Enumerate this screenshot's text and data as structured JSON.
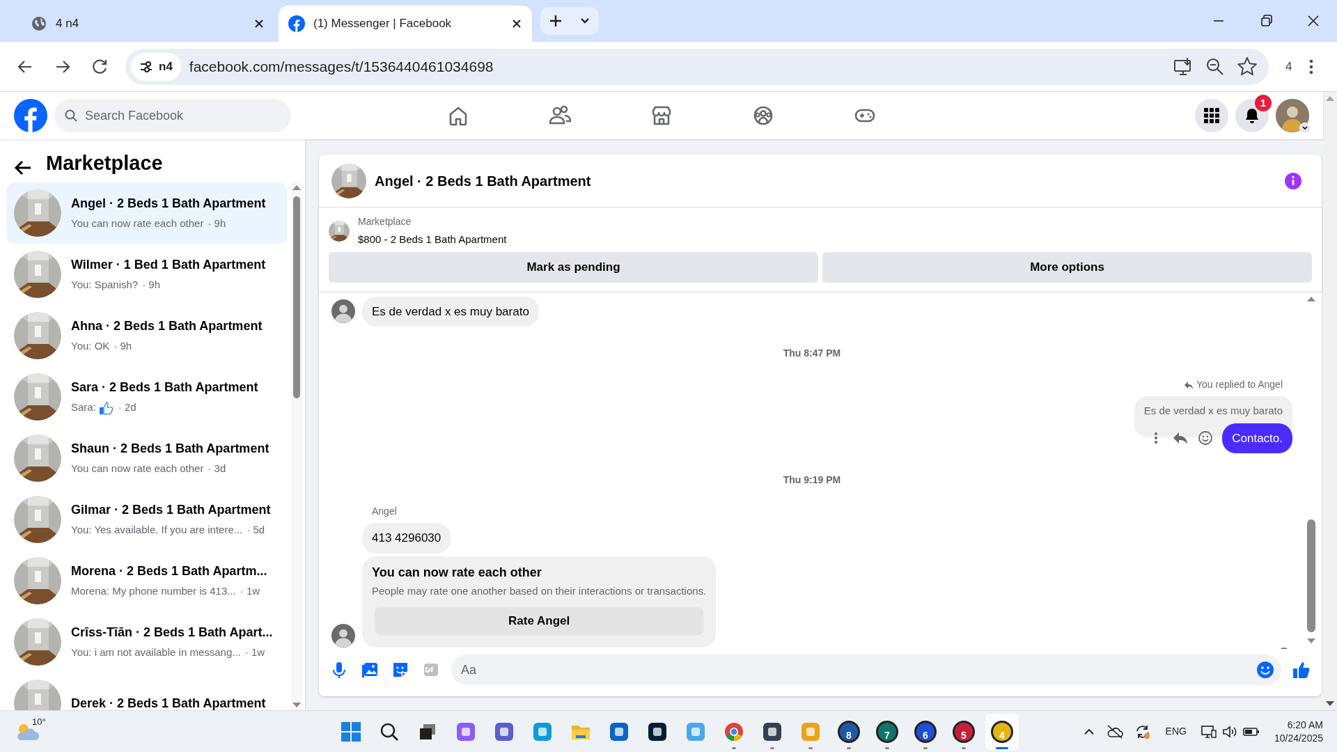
{
  "browser": {
    "tabs": [
      {
        "kind": "globe",
        "title": "4 n4",
        "selected": false
      },
      {
        "kind": "facebook",
        "title": "(1) Messenger | Facebook",
        "selected": true
      }
    ],
    "site_chip": "n4",
    "url": "facebook.com/messages/t/1536440461034698",
    "profile_label": "4"
  },
  "facebook_header": {
    "search_placeholder": "Search Facebook",
    "nav": [
      {
        "kind": "home"
      },
      {
        "kind": "friends"
      },
      {
        "kind": "marketplace"
      },
      {
        "kind": "groups"
      },
      {
        "kind": "gaming"
      }
    ],
    "notification_count": "1"
  },
  "sidebar": {
    "title": "Marketplace",
    "conversations": [
      {
        "name": "Angel · 2 Beds 1 Bath Apartment",
        "preview": "You can now rate each other",
        "like": false,
        "time": "· 9h",
        "selected": true
      },
      {
        "name": "Wilmer · 1 Bed 1 Bath Apartment",
        "preview": "You: Spanish?",
        "like": false,
        "time": "· 9h",
        "selected": false
      },
      {
        "name": "Ahna · 2 Beds 1 Bath Apartment",
        "preview": "You: OK",
        "like": false,
        "time": "· 9h",
        "selected": false
      },
      {
        "name": "Sara · 2 Beds 1 Bath Apartment",
        "preview": "Sara:",
        "like": true,
        "time": "· 2d",
        "selected": false
      },
      {
        "name": "Shaun · 2 Beds 1 Bath Apartment",
        "preview": "You can now rate each other",
        "like": false,
        "time": "· 3d",
        "selected": false
      },
      {
        "name": "Gilmar · 2 Beds 1 Bath Apartment",
        "preview": "You: Yes available. If you are intere...",
        "like": false,
        "time": "· 5d",
        "selected": false
      },
      {
        "name": "Morena · 2 Beds 1 Bath Apartm...",
        "preview": "Morena: My phone number is 413...",
        "like": false,
        "time": "· 1w",
        "selected": false
      },
      {
        "name": "Crīss-Tīān · 2 Beds 1 Bath Apart...",
        "preview": "You: i am not available in messang...",
        "like": false,
        "time": "· 1w",
        "selected": false
      },
      {
        "name": "Derek · 2 Beds 1 Bath Apartment",
        "selected": false
      }
    ]
  },
  "chat": {
    "title": "Angel · 2 Beds 1 Bath Apartment",
    "listing": {
      "label": "Marketplace",
      "title": "$800 - 2 Beds 1 Bath Apartment",
      "buttons": [
        "Mark as pending",
        "More options"
      ]
    },
    "messages": [
      {
        "kind": "incoming",
        "text": "Es de verdad x es muy barato",
        "avatar": true
      },
      {
        "kind": "timestamp",
        "text": "Thu 8:47 PM"
      },
      {
        "kind": "outgoing",
        "reply_label": "You replied to Angel",
        "quoted": "Es de verdad x es muy barato",
        "text": "Contacto."
      },
      {
        "kind": "timestamp",
        "text": "Thu 9:19 PM"
      },
      {
        "kind": "sender",
        "text": "Angel"
      },
      {
        "kind": "incoming",
        "text": "413 4296030",
        "avatar": false
      },
      {
        "kind": "rating",
        "title": "You can now rate each other",
        "body": "People may rate one another based on their interactions or transactions.",
        "button": "Rate Angel"
      }
    ],
    "composer_placeholder": "Aa"
  },
  "taskbar": {
    "weather": "10°",
    "apps": [
      {
        "kind": "start",
        "selected": false,
        "running": false
      },
      {
        "kind": "search",
        "selected": false,
        "running": false
      },
      {
        "kind": "taskview",
        "selected": false,
        "running": false
      },
      {
        "kind": "app",
        "color": "#8b5cf6",
        "selected": false,
        "running": false
      },
      {
        "kind": "app",
        "color": "#5b5fc7",
        "selected": false,
        "running": false
      },
      {
        "kind": "app",
        "color": "#0f9bd7",
        "selected": false,
        "running": false
      },
      {
        "kind": "folder",
        "selected": false,
        "running": false
      },
      {
        "kind": "app",
        "color": "#0a64c8",
        "selected": false,
        "running": false
      },
      {
        "kind": "app",
        "color": "#001e36",
        "selected": false,
        "running": false
      },
      {
        "kind": "app",
        "color": "#4aa8e8",
        "selected": false,
        "running": false
      },
      {
        "kind": "chrome",
        "selected": false,
        "running": true
      },
      {
        "kind": "app",
        "color": "#334155",
        "selected": false,
        "running": true
      },
      {
        "kind": "app",
        "color": "#e8a317",
        "selected": false,
        "running": true
      },
      {
        "kind": "gauge",
        "label": "8",
        "color": "#1e5aa8",
        "selected": false,
        "running": true
      },
      {
        "kind": "gauge",
        "label": "7",
        "color": "#0f766e",
        "selected": false,
        "running": true
      },
      {
        "kind": "gauge",
        "label": "6",
        "color": "#1d4ed8",
        "selected": false,
        "running": true
      },
      {
        "kind": "gauge",
        "label": "5",
        "color": "#c81e3c",
        "selected": false,
        "running": true
      },
      {
        "kind": "gauge",
        "label": "4",
        "color": "#e5b50f",
        "selected": true,
        "running": true
      }
    ],
    "language": "ENG",
    "time": "6:20 AM",
    "date": "10/24/2025"
  }
}
